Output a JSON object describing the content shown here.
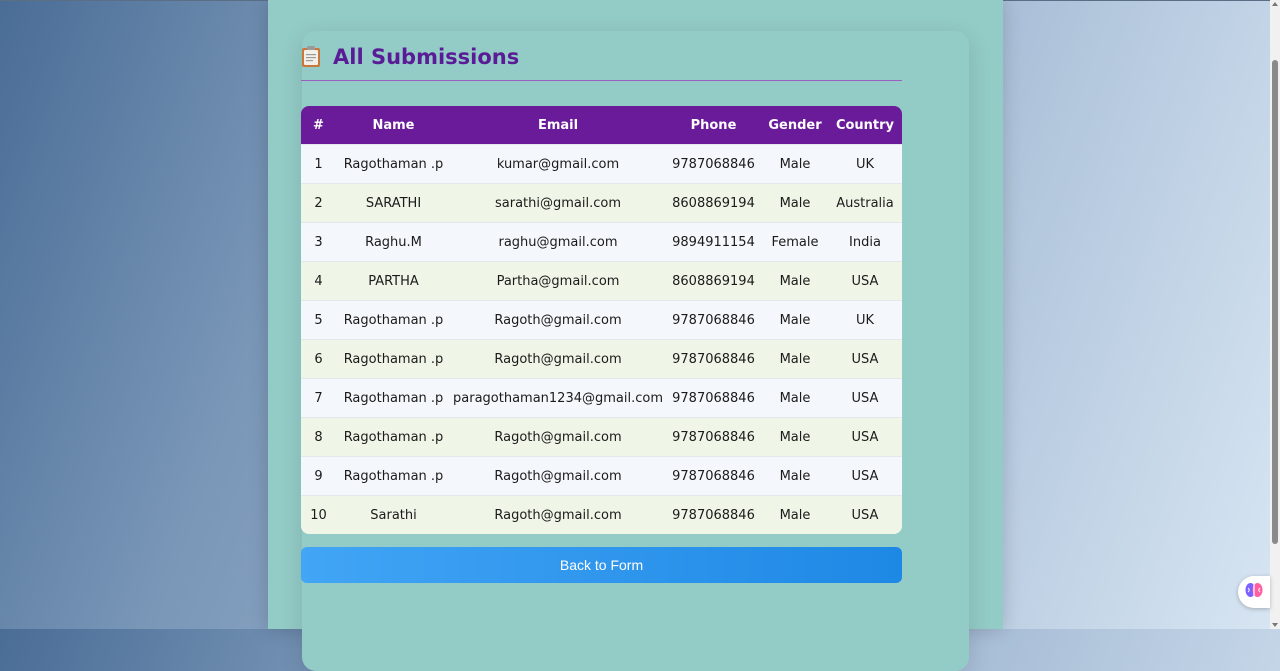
{
  "page": {
    "title": "All Submissions",
    "title_icon": "clipboard-icon",
    "colors": {
      "header_bg": "#6a1b9a",
      "title_color": "#5a1c96",
      "panel_bg": "#93cbc6",
      "button_start": "#42a5f5",
      "button_end": "#1e88e5"
    }
  },
  "table": {
    "headers": {
      "num": "#",
      "name": "Name",
      "email": "Email",
      "phone": "Phone",
      "gender": "Gender",
      "country": "Country"
    },
    "rows": [
      {
        "num": "1",
        "name": "Ragothaman .p",
        "email": "kumar@gmail.com",
        "phone": "9787068846",
        "gender": "Male",
        "country": "UK"
      },
      {
        "num": "2",
        "name": "SARATHI",
        "email": "sarathi@gmail.com",
        "phone": "8608869194",
        "gender": "Male",
        "country": "Australia"
      },
      {
        "num": "3",
        "name": "Raghu.M",
        "email": "raghu@gmail.com",
        "phone": "9894911154",
        "gender": "Female",
        "country": "India"
      },
      {
        "num": "4",
        "name": "PARTHA",
        "email": "Partha@gmail.com",
        "phone": "8608869194",
        "gender": "Male",
        "country": "USA"
      },
      {
        "num": "5",
        "name": "Ragothaman .p",
        "email": "Ragoth@gmail.com",
        "phone": "9787068846",
        "gender": "Male",
        "country": "UK"
      },
      {
        "num": "6",
        "name": "Ragothaman .p",
        "email": "Ragoth@gmail.com",
        "phone": "9787068846",
        "gender": "Male",
        "country": "USA"
      },
      {
        "num": "7",
        "name": "Ragothaman .p",
        "email": "paragothaman1234@gmail.com",
        "phone": "9787068846",
        "gender": "Male",
        "country": "USA"
      },
      {
        "num": "8",
        "name": "Ragothaman .p",
        "email": "Ragoth@gmail.com",
        "phone": "9787068846",
        "gender": "Male",
        "country": "USA"
      },
      {
        "num": "9",
        "name": "Ragothaman .p",
        "email": "Ragoth@gmail.com",
        "phone": "9787068846",
        "gender": "Male",
        "country": "USA"
      },
      {
        "num": "10",
        "name": "Sarathi",
        "email": "Ragoth@gmail.com",
        "phone": "9787068846",
        "gender": "Male",
        "country": "USA"
      }
    ]
  },
  "actions": {
    "back_label": "Back to Form"
  },
  "extension": {
    "icon": "brain-icon"
  }
}
